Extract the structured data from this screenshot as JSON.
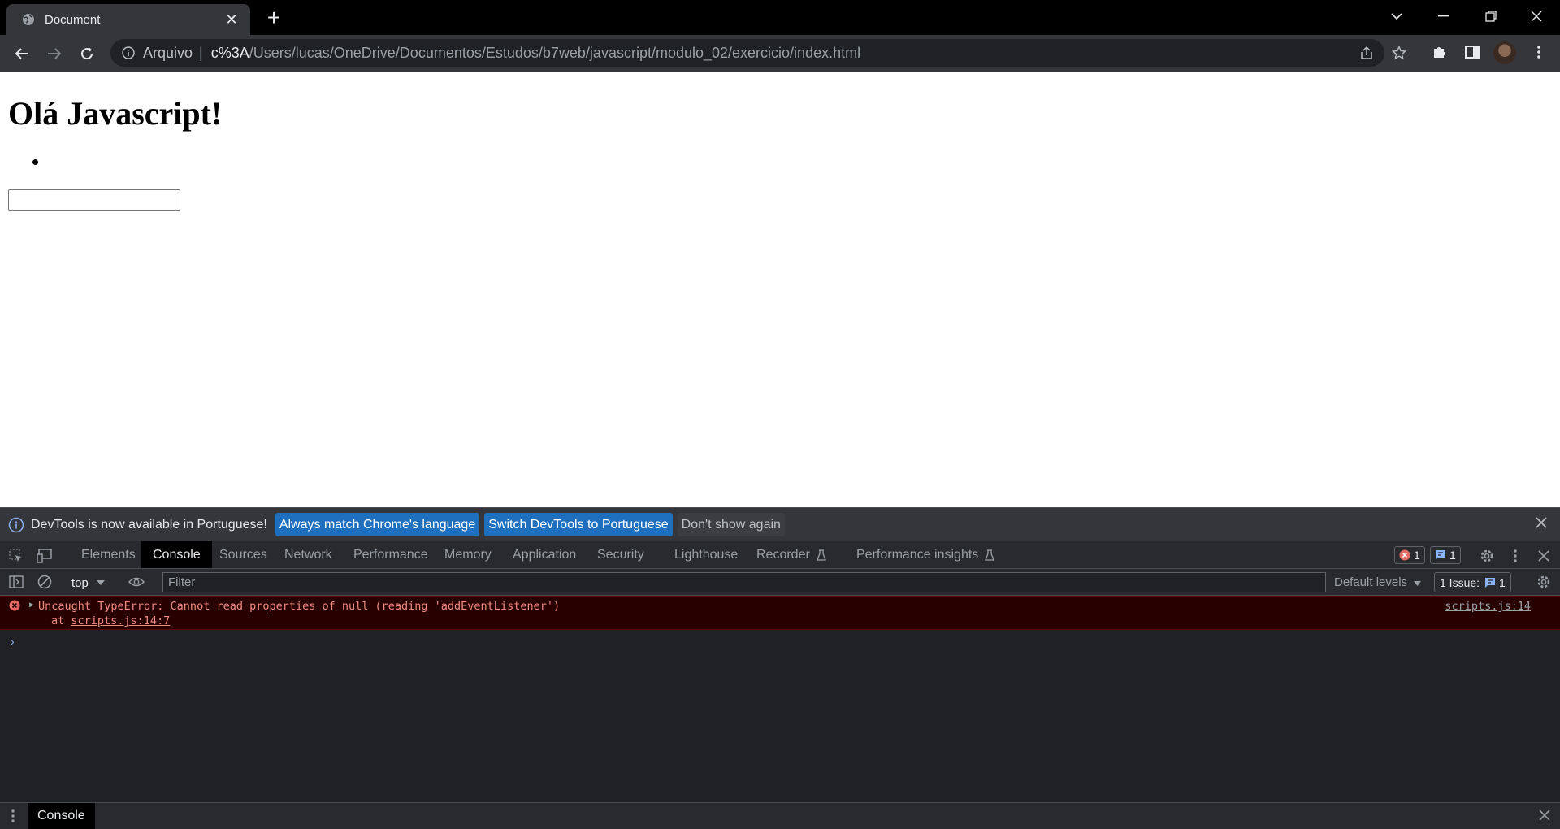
{
  "tab": {
    "title": "Document"
  },
  "omnibox": {
    "scheme_label": "Arquivo",
    "separator": "|",
    "host": "c%3A",
    "path": "/Users/lucas/OneDrive/Documentos/Estudos/b7web/javascript/modulo_02/exercicio/index.html"
  },
  "page": {
    "heading": "Olá Javascript!",
    "input_value": ""
  },
  "infobar": {
    "message": "DevTools is now available in Portuguese!",
    "btn_match": "Always match Chrome's language",
    "btn_switch": "Switch DevTools to Portuguese",
    "btn_dont_show": "Don't show again"
  },
  "devtools": {
    "tabs": [
      "Elements",
      "Console",
      "Sources",
      "Network",
      "Performance",
      "Memory",
      "Application",
      "Security",
      "Lighthouse",
      "Recorder",
      "Performance insights"
    ],
    "active_tab": "Console",
    "error_count": "1",
    "message_count": "1"
  },
  "console_bar": {
    "context": "top",
    "filter_placeholder": "Filter",
    "levels": "Default levels",
    "issues_label": "1 Issue:",
    "issues_count": "1"
  },
  "console": {
    "error_line1": "Uncaught TypeError: Cannot read properties of null (reading 'addEventListener')",
    "error_at": "at ",
    "error_link": "scripts.js:14:7",
    "error_source": "scripts.js:14",
    "prompt": "›"
  },
  "drawer": {
    "tab": "Console"
  },
  "colors": {
    "error_bg": "#290000",
    "error_text": "#f28b82",
    "accent_button": "#1f6fbf"
  }
}
